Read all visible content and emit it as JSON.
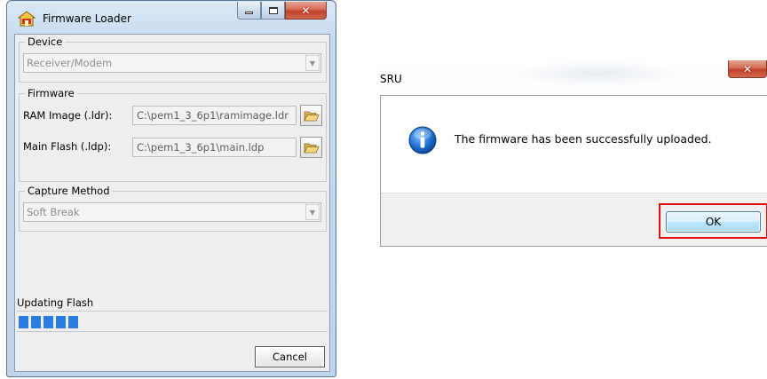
{
  "firmware_loader": {
    "title": "Firmware Loader",
    "app_icon": "house-icon",
    "caption_buttons": {
      "minimize": "minimize-icon",
      "maximize": "maximize-icon",
      "close": "close-icon"
    },
    "device": {
      "legend": "Device",
      "selected": "Receiver/Modem"
    },
    "firmware": {
      "legend": "Firmware",
      "ram_image_label": "RAM Image (.ldr):",
      "ram_image_path": "C:\\pem1_3_6p1\\ramimage.ldr",
      "main_flash_label": "Main Flash (.ldp):",
      "main_flash_path": "C:\\pem1_3_6p1\\main.ldp",
      "browse_icon": "folder-open-icon"
    },
    "capture_method": {
      "legend": "Capture Method",
      "selected": "Soft Break"
    },
    "progress": {
      "status": "Updating Flash",
      "fraction": 0.2
    },
    "cancel_label": "Cancel"
  },
  "sru_dialog": {
    "title": "SRU",
    "close_icon": "close-icon",
    "icon": "info-icon",
    "message": "The firmware has been successfully uploaded.",
    "ok_label": "OK",
    "highlight_color": "#e01010"
  }
}
